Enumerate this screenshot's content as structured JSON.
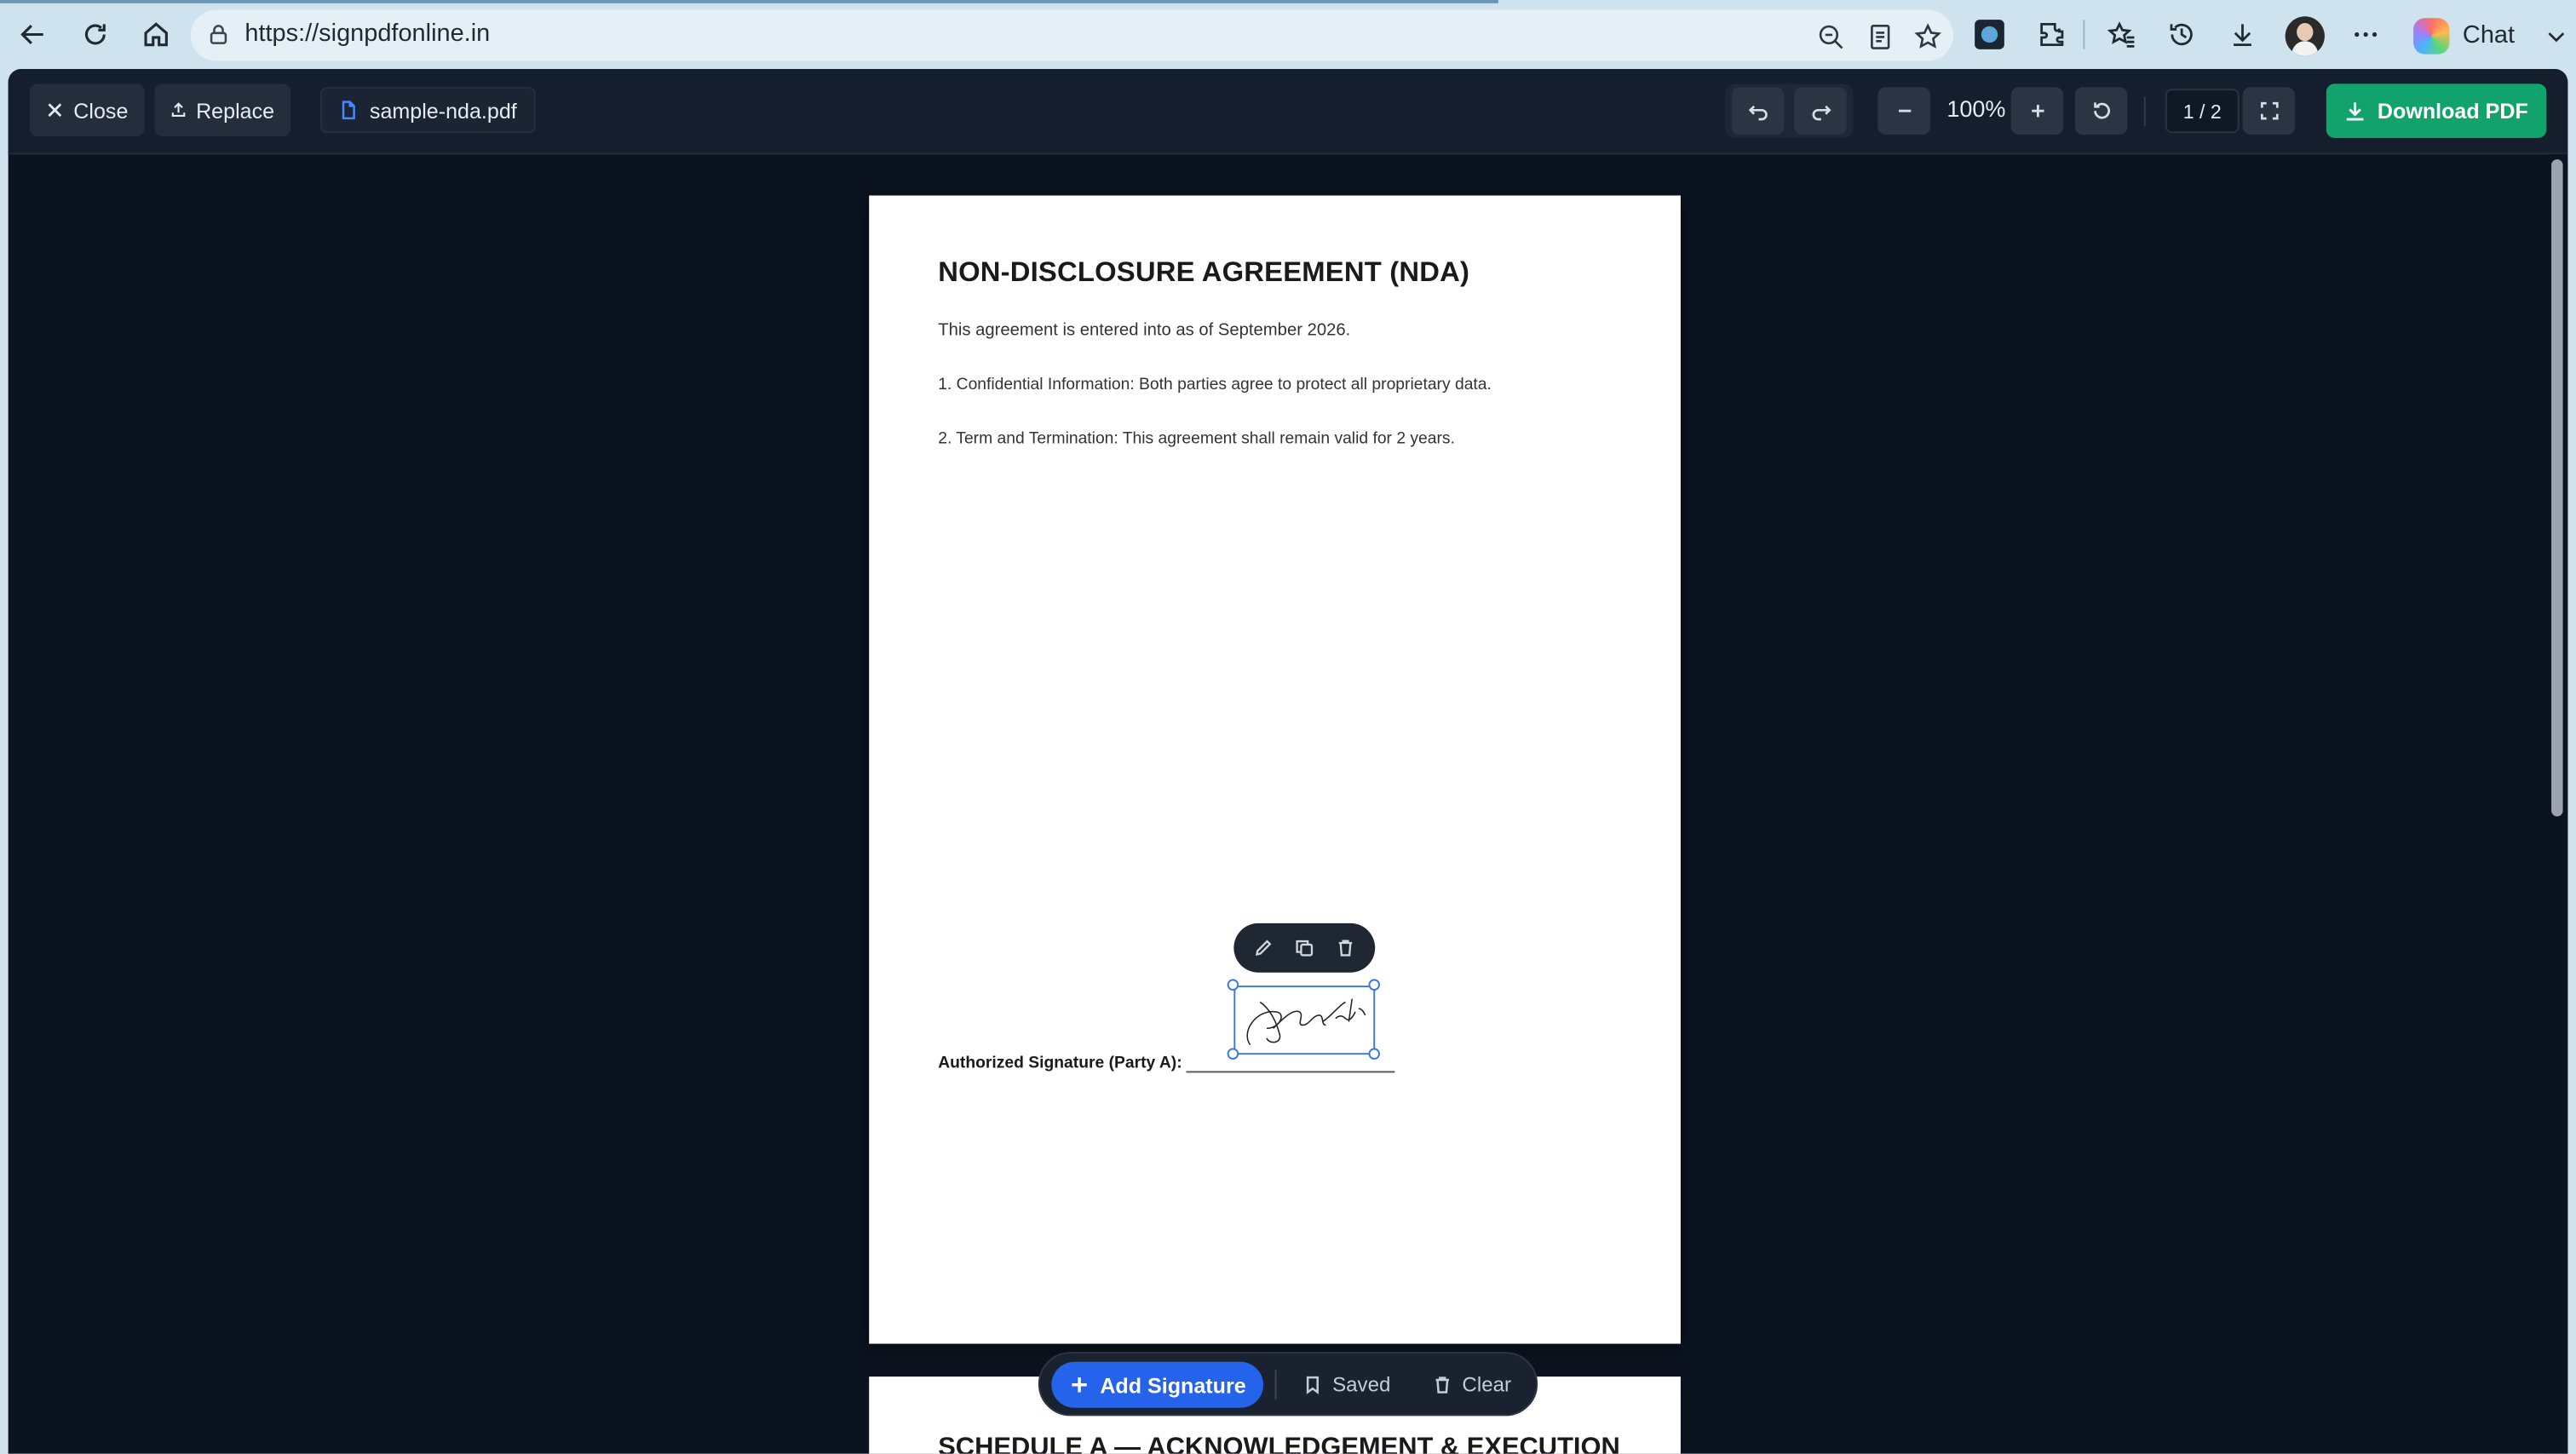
{
  "browser": {
    "url": "https://signpdfonline.in",
    "chat_label": "Chat"
  },
  "toolbar": {
    "close_label": "Close",
    "replace_label": "Replace",
    "file_name": "sample-nda.pdf",
    "zoom_level": "100%",
    "page_indicator": "1 / 2",
    "download_label": "Download PDF"
  },
  "document": {
    "title": "NON-DISCLOSURE AGREEMENT (NDA)",
    "intro": "This agreement is entered into as of September 2026.",
    "clauses": [
      "1. Confidential Information: Both parties agree to protect all proprietary data.",
      "2. Term and Termination: This agreement shall remain valid for 2 years."
    ],
    "signature_label": "Authorized Signature (Party A):",
    "page2_title": "SCHEDULE A — ACKNOWLEDGEMENT & EXECUTION"
  },
  "bottom_bar": {
    "add_signature_label": "Add Signature",
    "saved_label": "Saved",
    "clear_label": "Clear"
  },
  "colors": {
    "download": "#12a26c",
    "add_signature": "#2563eb",
    "selection": "#3a78e0",
    "app_bg": "#0b1320"
  }
}
